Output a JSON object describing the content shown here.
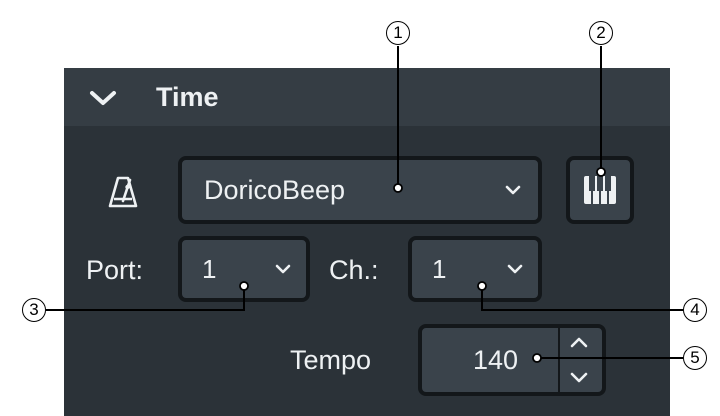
{
  "panel": {
    "title": "Time",
    "collapse_icon": "chevron-down-icon"
  },
  "click": {
    "metronome_icon": "metronome-icon",
    "device": {
      "value": "DoricoBeep",
      "icon": "chevron-down-icon"
    },
    "keyboard_button_icon": "piano-keyboard-icon",
    "port": {
      "label": "Port:",
      "value": "1"
    },
    "channel": {
      "label": "Ch.:",
      "value": "1"
    },
    "tempo": {
      "label": "Tempo",
      "value": "140"
    }
  },
  "callouts": [
    "1",
    "2",
    "3",
    "4",
    "5"
  ],
  "colors": {
    "panel_bg": "#2b3238",
    "header_bg": "#353d44",
    "field_bg": "#3a434b",
    "field_border": "#13171a",
    "text": "#eef1f3"
  }
}
